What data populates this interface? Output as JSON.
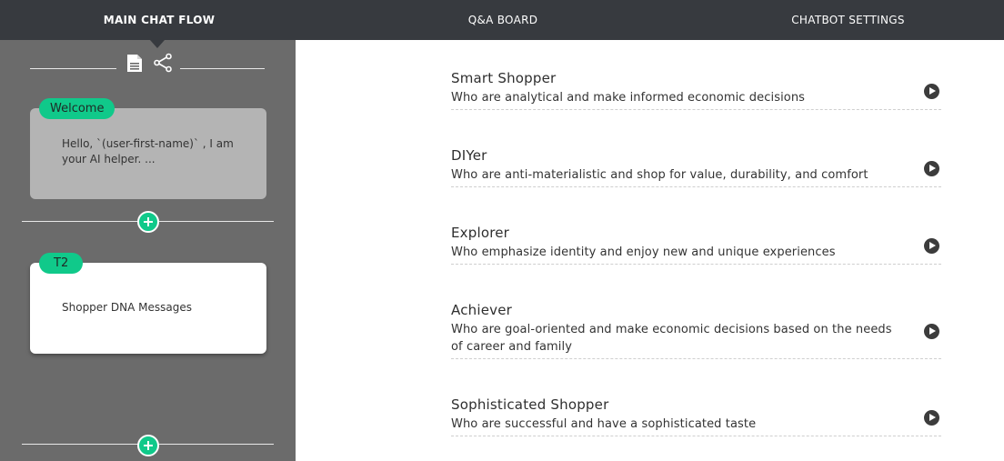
{
  "tabs": {
    "main_chat_flow": "MAIN CHAT FLOW",
    "qa_board": "Q&A BOARD",
    "chatbot_settings": "CHATBOT SETTINGS"
  },
  "sidebar": {
    "toolbar_icons": [
      "document-icon",
      "share-icon"
    ],
    "nodes": [
      {
        "tag": "Welcome",
        "text": "Hello, `(user-first-name)` , I am your AI helper. ..."
      },
      {
        "tag": "T2",
        "text": "Shopper DNA Messages"
      }
    ],
    "add_button_icon": "plus-icon"
  },
  "personas": [
    {
      "title": "Smart Shopper",
      "description": "Who are analytical and make informed economic decisions"
    },
    {
      "title": "DIYer",
      "description": "Who are anti-materialistic and shop for value, durability, and comfort"
    },
    {
      "title": "Explorer",
      "description": "Who emphasize identity and enjoy new and unique experiences"
    },
    {
      "title": "Achiever",
      "description": "Who are goal-oriented and make economic decisions based on the needs of career and family"
    },
    {
      "title": "Sophisticated Shopper",
      "description": "Who are successful and have a sophisticated taste"
    }
  ],
  "colors": {
    "topbar": "#373a3f",
    "sidebar": "#6b6b6b",
    "accent": "#10c98a",
    "welcome_node": "#b4b4b4"
  }
}
